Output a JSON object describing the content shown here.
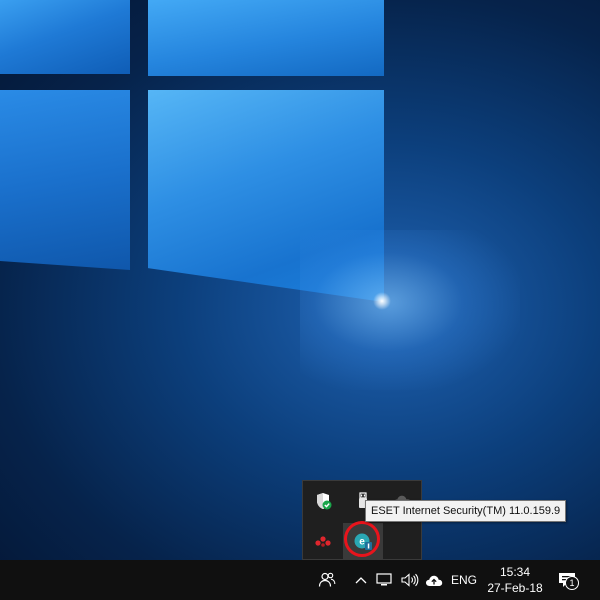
{
  "tooltip": {
    "text": "ESET Internet Security(TM) 11.0.159.9"
  },
  "tray_overflow": {
    "icons": [
      {
        "name": "windows-defender-icon",
        "active": false
      },
      {
        "name": "usb-safely-remove-icon",
        "active": false
      },
      {
        "name": "onedrive-icon",
        "active": false
      },
      {
        "name": "red-app-icon",
        "active": false
      },
      {
        "name": "eset-icon",
        "active": true
      }
    ]
  },
  "taskbar": {
    "people_icon": "people-icon",
    "show_hidden_icon": "chevron-up-icon",
    "language": "ENG",
    "clock": {
      "time": "15:34",
      "date": "27-Feb-18"
    },
    "notifications_count": "1"
  },
  "colors": {
    "taskbar": "#101010",
    "highlight_ring": "#e8141c",
    "defender_green": "#1aa64a",
    "eset_teal": "#2aa7b4"
  }
}
